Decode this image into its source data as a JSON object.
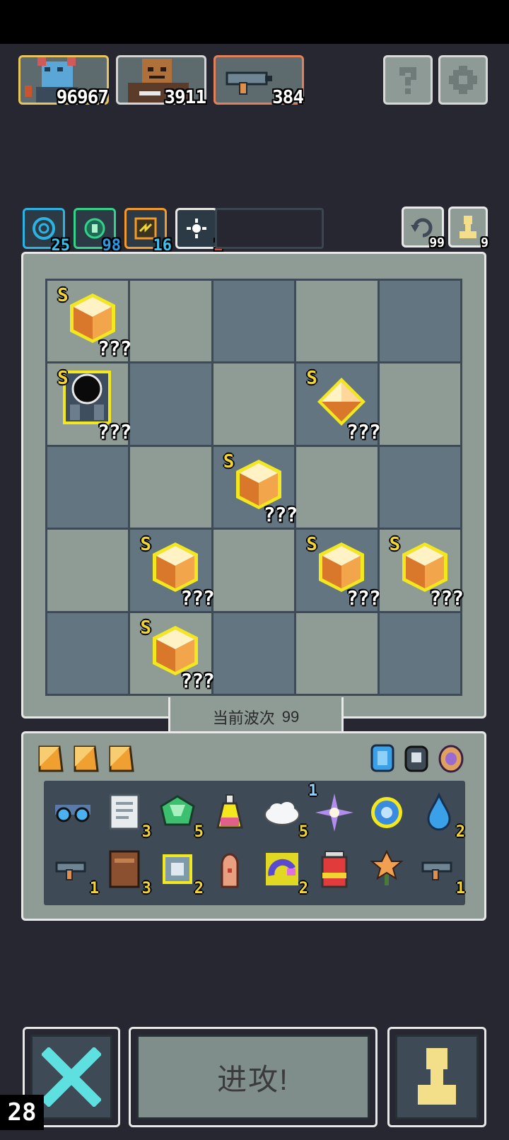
{
  "resources": [
    {
      "name": "hero",
      "value": "96967",
      "border": "#e7c45c"
    },
    {
      "name": "brute",
      "value": "3911",
      "border": "#d5d5d5"
    },
    {
      "name": "gun",
      "value": "384",
      "border": "#e3805a"
    }
  ],
  "top_buttons": {
    "help_icon": "question-icon",
    "settings_icon": "gear-icon"
  },
  "buffs": [
    {
      "icon": "spiral-icon",
      "value": "25",
      "color": "#2bb3e4"
    },
    {
      "icon": "orb-icon",
      "value": "98",
      "color": "#32d38a"
    },
    {
      "icon": "lightning-icon",
      "value": "16",
      "color": "#f39a2a"
    },
    {
      "icon": "sun-icon",
      "value": "1",
      "color": "#e8e8e8"
    }
  ],
  "counters": {
    "refresh": "99",
    "pawn": "9"
  },
  "board": {
    "rows": 5,
    "cols": 5,
    "pieces": [
      {
        "row": 0,
        "col": 0,
        "rank": "S",
        "label": "???",
        "kind": "cube"
      },
      {
        "row": 1,
        "col": 0,
        "rank": "S",
        "label": "???",
        "kind": "robot"
      },
      {
        "row": 1,
        "col": 3,
        "rank": "S",
        "label": "???",
        "kind": "octa"
      },
      {
        "row": 2,
        "col": 2,
        "rank": "S",
        "label": "???",
        "kind": "cube"
      },
      {
        "row": 3,
        "col": 1,
        "rank": "S",
        "label": "???",
        "kind": "cube"
      },
      {
        "row": 3,
        "col": 3,
        "rank": "S",
        "label": "???",
        "kind": "cube"
      },
      {
        "row": 3,
        "col": 4,
        "rank": "S",
        "label": "???",
        "kind": "cube"
      },
      {
        "row": 4,
        "col": 1,
        "rank": "S",
        "label": "???",
        "kind": "cube"
      }
    ]
  },
  "wave": {
    "label": "当前波次",
    "number": "99"
  },
  "inventory": {
    "row1": [
      {
        "icon": "goggles-icon",
        "count": ""
      },
      {
        "icon": "scroll-icon",
        "count": "3"
      },
      {
        "icon": "emerald-icon",
        "count": "5"
      },
      {
        "icon": "potion-icon",
        "count": ""
      },
      {
        "icon": "cloud-icon",
        "count": "5"
      },
      {
        "icon": "star-burst-icon",
        "count": "1",
        "count_top": true
      },
      {
        "icon": "ring-icon",
        "count": ""
      },
      {
        "icon": "water-drop-icon",
        "count": "2"
      }
    ],
    "row2": [
      {
        "icon": "blaster-icon",
        "count": "1"
      },
      {
        "icon": "book-icon",
        "count": "3"
      },
      {
        "icon": "chip-icon",
        "count": "2"
      },
      {
        "icon": "bullet-icon",
        "count": ""
      },
      {
        "icon": "magnet-icon",
        "count": "2"
      },
      {
        "icon": "battery-icon",
        "count": ""
      },
      {
        "icon": "flower-icon",
        "count": ""
      },
      {
        "icon": "blaster-icon",
        "count": "1"
      }
    ]
  },
  "buttons": {
    "attack": "进攻!"
  },
  "fps": "28"
}
